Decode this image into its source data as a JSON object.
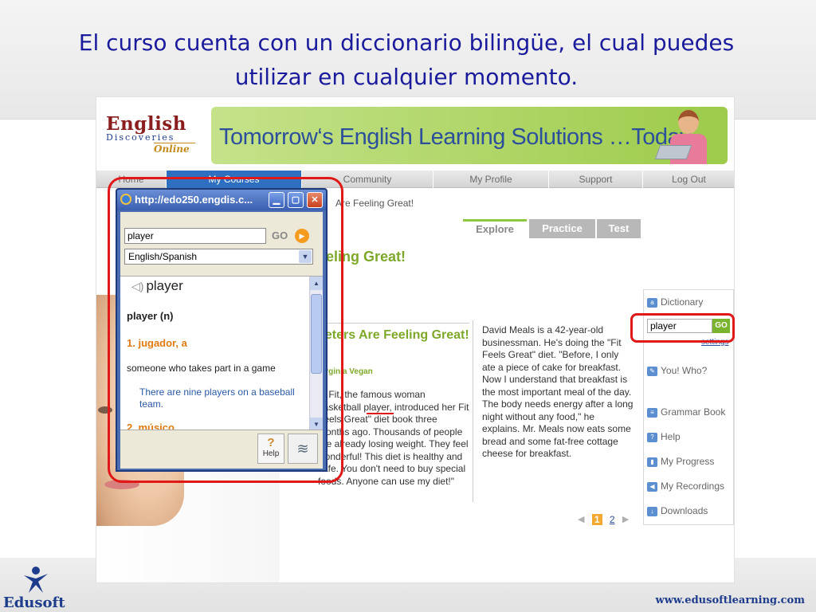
{
  "slide": {
    "title_line1": "El curso cuenta con un diccionario bilingüe, el cual puedes",
    "title_line2": "utilizar en cualquier momento.",
    "brand": "Edusoft",
    "website": "www.edusoftlearning.com"
  },
  "site": {
    "logo_line1": "English",
    "logo_line2": "Discoveries",
    "logo_line3": "Online",
    "banner": "Tomorrow‘s English Learning Solutions …Today"
  },
  "nav": {
    "items": [
      "Home",
      "My Courses",
      "Community",
      "My Profile",
      "Support",
      "Log Out"
    ]
  },
  "breadcrumb": "Are Feeling Great!",
  "tabs": [
    "Explore",
    "Practice",
    "Test"
  ],
  "article": {
    "main_title": "eeling Great!",
    "sub_title": "lieters Are Feeling Great!",
    "byline": "Virginia Vegan",
    "col1": "m Fit, the famous woman basketball player, introduced her Fit Feels Great\" diet book three months ago. Thousands of people are already losing weight. They feel wonderful! This diet is healthy and safe. You don't need to buy special foods. Anyone can use my diet!\"",
    "col2": "David Meals is a 42-year-old businessman. He's doing the \"Fit Feels Great\" diet. \"Before, I only ate a piece of cake for breakfast. Now I understand that breakfast is the most important meal of the day. The body needs energy after a long night without any food,\" he explains. Mr. Meals now eats some bread and some fat-free cottage cheese for breakfast."
  },
  "pager": {
    "current": "1",
    "next": "2"
  },
  "sidebar": {
    "dictionary_label": "Dictionary",
    "dictionary_value": "player",
    "go_label": "GO",
    "settings_label": "settings",
    "items": [
      "You! Who?",
      "Grammar Book",
      "Help",
      "My Progress",
      "My Recordings",
      "Downloads"
    ]
  },
  "popup": {
    "title": "http://edo250.engdis.c...",
    "search_value": "player",
    "go_label": "GO",
    "language": "English/Spanish",
    "headword": "player",
    "pos": "player (n)",
    "def1": "1. jugador, a",
    "gloss1": "someone who takes part in a game",
    "example1": "There are nine players on a baseball team.",
    "def2": "2. músico",
    "help_label": "Help"
  },
  "colors": {
    "title_blue": "#1a1a9c",
    "nav_active": "#2e6fc0",
    "accent_green": "#7ea82a",
    "annotation_red": "#e01818",
    "definition_orange": "#e07a10"
  }
}
